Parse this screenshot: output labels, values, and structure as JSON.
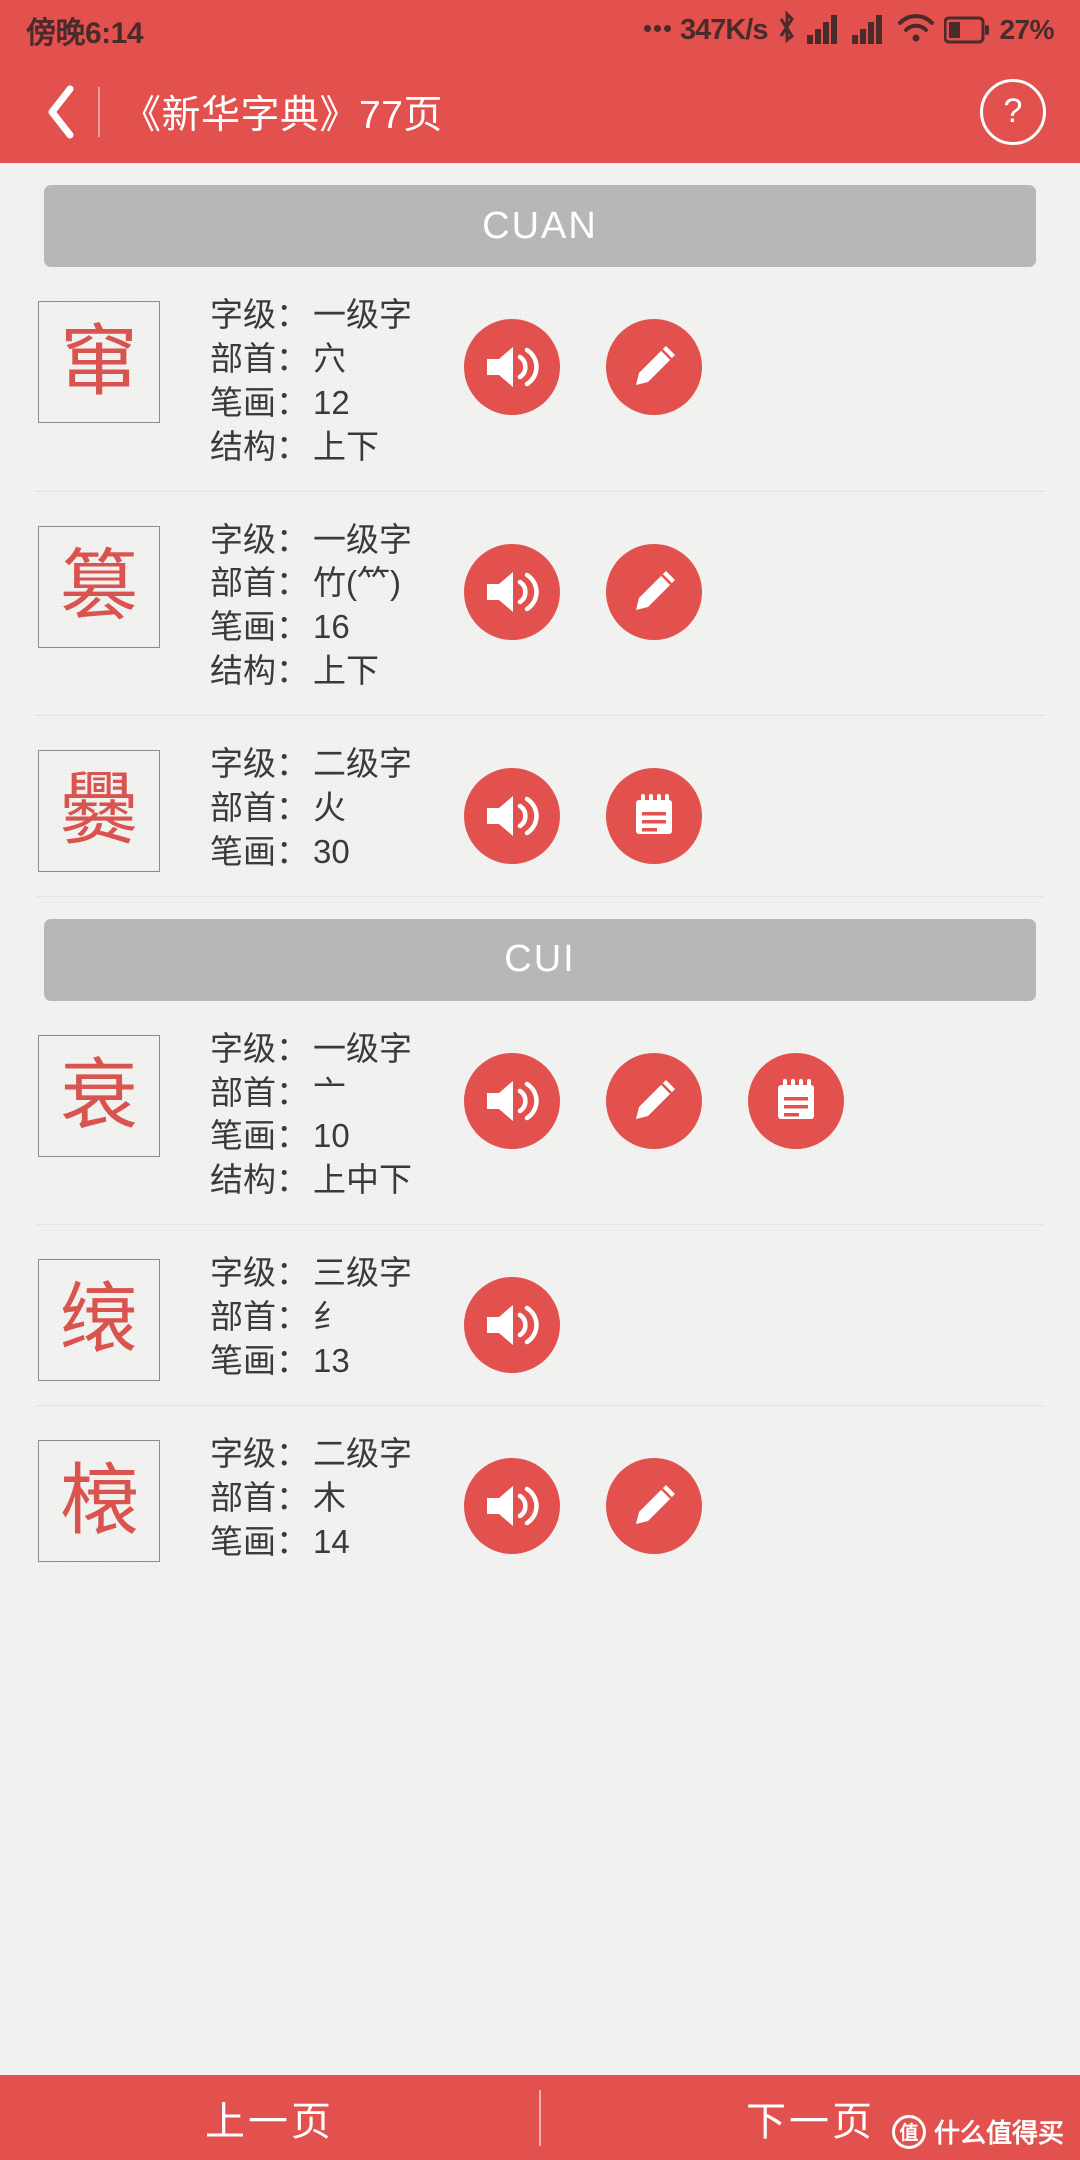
{
  "statusbar": {
    "time": "傍晚6:14",
    "network_speed": "347K/s",
    "battery_percent": "27%",
    "icons": [
      "dots-icon",
      "bluetooth-icon",
      "signal-icon",
      "signal-icon",
      "wifi-icon",
      "battery-icon"
    ]
  },
  "appbar": {
    "back_icon": "chevron-left-icon",
    "title": "《新华字典》77页",
    "help_label": "?"
  },
  "colors": {
    "brand_red": "#e2514e",
    "char_red": "#d9534f",
    "section_gray": "#b7b7b7",
    "page_bg": "#f2f2f0"
  },
  "labels": {
    "level": "字级：",
    "radical": "部首：",
    "strokes": "笔画：",
    "structure": "结构："
  },
  "sections": [
    {
      "name": "CUAN",
      "entries": [
        {
          "char": "窜",
          "level": "一级字",
          "radical": "穴",
          "strokes": "12",
          "structure": "上下",
          "actions": [
            "speaker-icon",
            "pencil-icon"
          ]
        },
        {
          "char": "篡",
          "level": "一级字",
          "radical": "竹(⺮)",
          "strokes": "16",
          "structure": "上下",
          "actions": [
            "speaker-icon",
            "pencil-icon"
          ]
        },
        {
          "char": "爨",
          "level": "二级字",
          "radical": "火",
          "strokes": "30",
          "structure": "",
          "actions": [
            "speaker-icon",
            "notebook-icon"
          ]
        }
      ]
    },
    {
      "name": "CUI",
      "entries": [
        {
          "char": "衰",
          "level": "一级字",
          "radical": "亠",
          "strokes": "10",
          "structure": "上中下",
          "actions": [
            "speaker-icon",
            "pencil-icon",
            "notebook-icon"
          ]
        },
        {
          "char": "缞",
          "level": "三级字",
          "radical": "纟",
          "strokes": "13",
          "structure": "",
          "actions": [
            "speaker-icon"
          ]
        },
        {
          "char": "榱",
          "level": "二级字",
          "radical": "木",
          "strokes": "14",
          "structure": "",
          "actions": [
            "speaker-icon",
            "pencil-icon"
          ]
        }
      ]
    }
  ],
  "bottombar": {
    "prev_label": "上一页",
    "next_label": "下一页"
  },
  "watermark": {
    "badge": "值",
    "text": "什么值得买"
  }
}
